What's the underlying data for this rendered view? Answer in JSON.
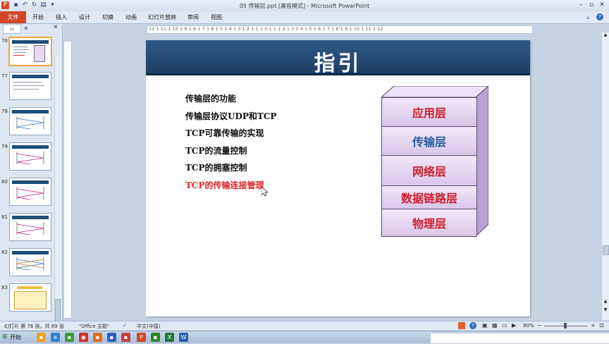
{
  "window": {
    "title": "05 传输层.ppt [兼容模式] - Microsoft PowerPoint"
  },
  "quick_access": {
    "save_icon": "save-icon",
    "undo_icon": "undo-icon",
    "redo_icon": "redo-icon"
  },
  "ribbon_tabs": [
    "文件",
    "开始",
    "插入",
    "设计",
    "切换",
    "动画",
    "幻灯片放映",
    "审阅",
    "视图"
  ],
  "panel_tabs": {
    "slides": "",
    "outline": ""
  },
  "slide_thumbnails": [
    {
      "num": "76",
      "selected": true
    },
    {
      "num": "77"
    },
    {
      "num": "78"
    },
    {
      "num": "79"
    },
    {
      "num": "80"
    },
    {
      "num": "81"
    },
    {
      "num": "82"
    },
    {
      "num": "83"
    }
  ],
  "ruler": {
    "marks": "·12·1·11·1·10·1·9·1·8·1·7·1·6·1·5·1·4·1·3·1·2·1·1·1·0·1·1·1·2·1·3·1·4·1·5·1·6·1·7·1·8·1·9·1·10·1·11·1·12"
  },
  "slide": {
    "title": "指引",
    "bullets": [
      {
        "text": "传输层的功能",
        "highlight": false
      },
      {
        "text": "传输层协议UDP和TCP",
        "highlight": false
      },
      {
        "text": "TCP可靠传输的实现",
        "highlight": false
      },
      {
        "text": "TCP的流量控制",
        "highlight": false
      },
      {
        "text": "TCP的拥塞控制",
        "highlight": false
      },
      {
        "text": "TCP的传输连接管理",
        "highlight": true
      }
    ],
    "layers": [
      {
        "label": "应用层",
        "color": "#cc1f2a"
      },
      {
        "label": "传输层",
        "color": "#2a5f9e"
      },
      {
        "label": "网络层",
        "color": "#cc1f2a"
      },
      {
        "label": "数据链路层",
        "color": "#cc1f2a"
      },
      {
        "label": "物理层",
        "color": "#cc1f2a"
      }
    ],
    "highlight_color": "#e0242a"
  },
  "status": {
    "slide_info": "幻灯片 第 76 张，共 89 张",
    "theme": "\"Office 主题\"",
    "language": "中文(中国)",
    "zoom": "90%"
  },
  "taskbar": {
    "start": "开始"
  }
}
